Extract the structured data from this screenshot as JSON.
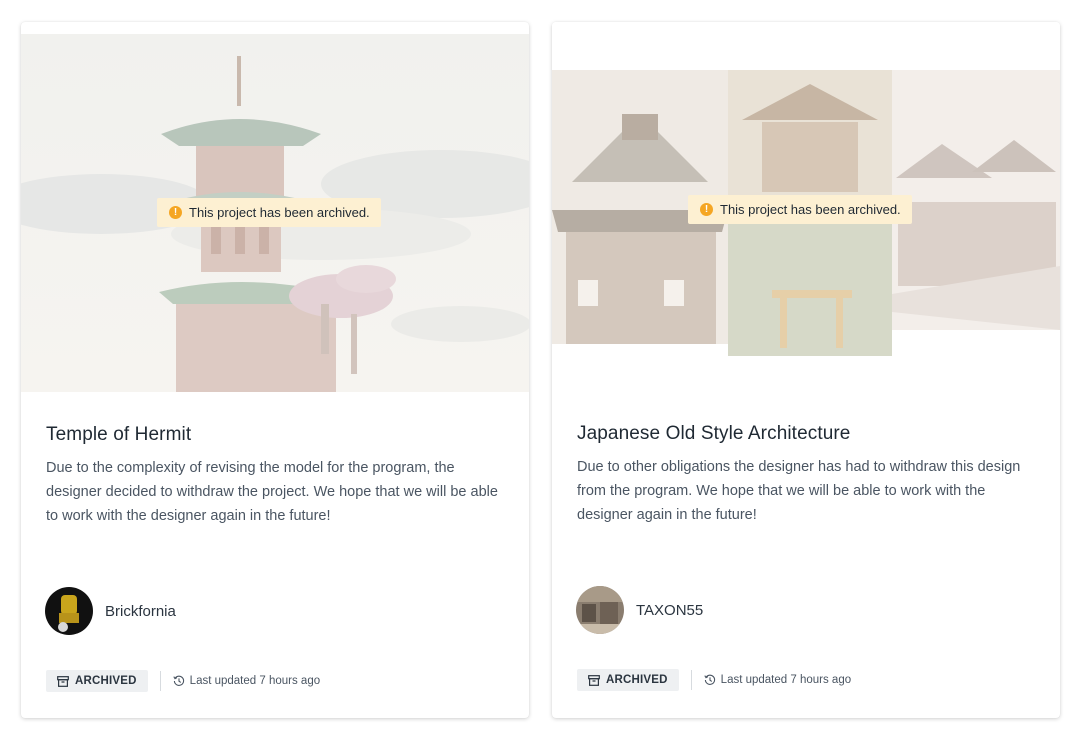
{
  "projects": [
    {
      "image_alt": "Temple of Hermit",
      "archive_notice": "This project has been archived.",
      "title": "Temple of Hermit",
      "description": "Due to the complexity of revising the model for the program, the designer decided to withdraw the project. We hope that we will be able to work with the designer again in the future!",
      "author": "Brickfornia",
      "status": "ARCHIVED",
      "updated": "Last updated 7 hours ago"
    },
    {
      "image_alt": "Japanese Old Style Architecture",
      "archive_notice": "This project has been archived.",
      "title": "Japanese Old Style Architecture",
      "description": "Due to other obligations the designer has had to withdraw this design from the program. We hope that we will be able to work with the designer again in the future!",
      "author": "TAXON55",
      "status": "ARCHIVED",
      "updated": "Last updated 7 hours ago"
    }
  ],
  "icons": {
    "warning": "warning-icon",
    "archive": "archive-box-icon",
    "history": "history-clock-icon"
  },
  "colors": {
    "notice_bg": "#fdf0d2",
    "warning": "#f5a623",
    "badge_bg": "#eef0f2",
    "text": "#1f2933",
    "muted": "#4a5562"
  }
}
